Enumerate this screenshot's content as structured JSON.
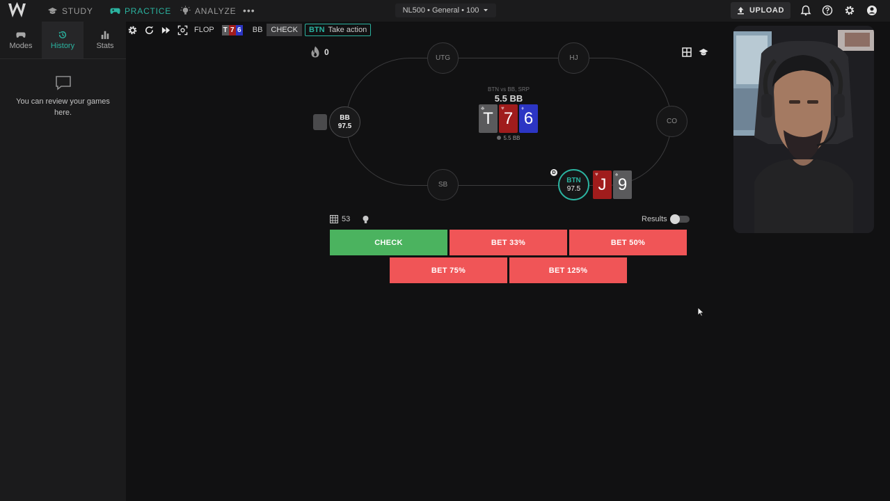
{
  "nav": {
    "study": "STUDY",
    "practice": "PRACTICE",
    "analyze": "ANALYZE",
    "more": "•••",
    "game_select": "NL500 • General • 100",
    "upload": "UPLOAD"
  },
  "sidebar": {
    "tabs": [
      {
        "label": "Modes"
      },
      {
        "label": "History",
        "active": true
      },
      {
        "label": "Stats"
      }
    ],
    "empty_text": "You can review your games here."
  },
  "hand_bar": {
    "street": "FLOP",
    "board": [
      "T",
      "7",
      "6"
    ],
    "bb_label": "BB",
    "bb_action": "CHECK",
    "hero_pos": "BTN",
    "prompt": "Take action"
  },
  "streak": "0",
  "table": {
    "seats": {
      "utg": "UTG",
      "hj": "HJ",
      "co": "CO",
      "sb": "SB",
      "bb": {
        "pos": "BB",
        "stack": "97.5"
      },
      "btn": {
        "pos": "BTN",
        "stack": "97.5"
      }
    },
    "pot_label": "BTN vs BB, SRP",
    "pot_total": "5.5 BB",
    "pot_chips": "5.5 BB",
    "dealer_button": "D",
    "board_cards": [
      {
        "rank": "T",
        "suit": "♣",
        "color": "#5a5a5c"
      },
      {
        "rank": "7",
        "suit": "♥",
        "color": "#a01c1c"
      },
      {
        "rank": "6",
        "suit": "♦",
        "color": "#2c35c4"
      }
    ],
    "hero_cards": [
      {
        "rank": "J",
        "suit": "♥",
        "color": "#a01c1c"
      },
      {
        "rank": "9",
        "suit": "♠",
        "color": "#5a5a5c"
      }
    ]
  },
  "combos": "53",
  "results_label": "Results",
  "actions": {
    "check": "CHECK",
    "bet33": "BET 33%",
    "bet50": "BET 50%",
    "bet75": "BET 75%",
    "bet125": "BET 125%"
  },
  "colors": {
    "accent": "#2bb3a0",
    "check": "#4bb35f",
    "bet": "#f05557"
  }
}
